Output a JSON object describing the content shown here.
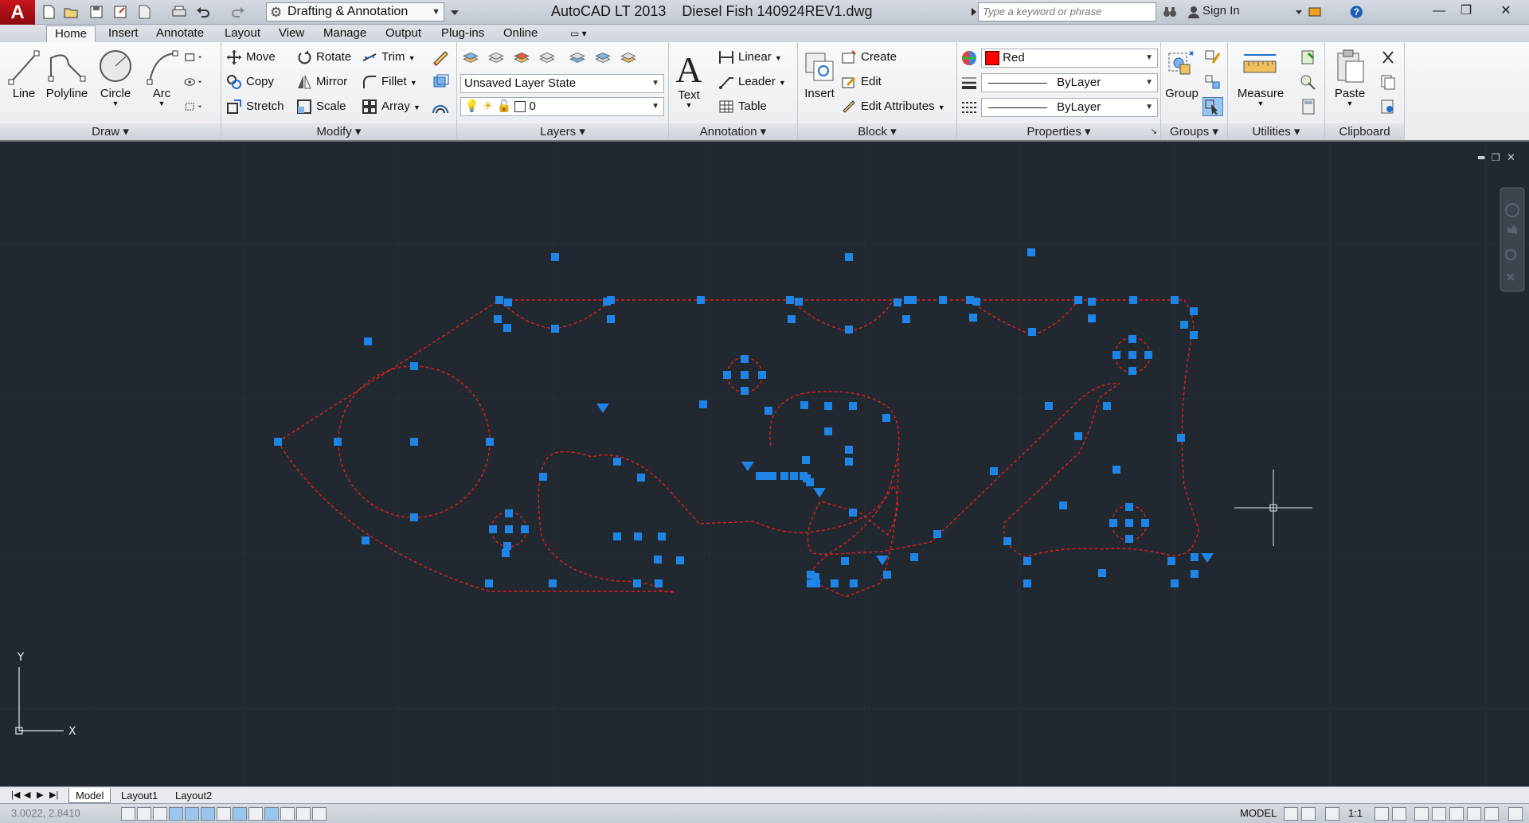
{
  "app": {
    "title": "AutoCAD LT 2013    Diesel Fish 140924REV1.dwg",
    "logo": "A",
    "workspace": "Drafting & Annotation",
    "search_placeholder": "Type a keyword or phrase",
    "signin": "Sign In",
    "help": "?"
  },
  "tabs": [
    "Home",
    "Insert",
    "Annotate",
    "Layout",
    "View",
    "Manage",
    "Output",
    "Plug-ins",
    "Online"
  ],
  "draw": {
    "title": "Draw",
    "line": "Line",
    "polyline": "Polyline",
    "circle": "Circle",
    "arc": "Arc"
  },
  "modify": {
    "title": "Modify",
    "move": "Move",
    "rotate": "Rotate",
    "trim": "Trim",
    "copy": "Copy",
    "mirror": "Mirror",
    "fillet": "Fillet",
    "stretch": "Stretch",
    "scale": "Scale",
    "array": "Array"
  },
  "layers": {
    "title": "Layers",
    "state": "Unsaved Layer State",
    "current": "0"
  },
  "annotation": {
    "title": "Annotation",
    "text": "Text",
    "linear": "Linear",
    "leader": "Leader",
    "table": "Table"
  },
  "block": {
    "title": "Block",
    "insert": "Insert",
    "create": "Create",
    "edit": "Edit",
    "edit_attributes": "Edit Attributes"
  },
  "properties": {
    "title": "Properties",
    "color": "Red",
    "color_hex": "#ff0000",
    "linetype": "ByLayer",
    "lineweight": "ByLayer"
  },
  "groups": {
    "title": "Groups",
    "group": "Group"
  },
  "utilities": {
    "title": "Utilities",
    "measure": "Measure"
  },
  "clipboard": {
    "title": "Clipboard",
    "paste": "Paste"
  },
  "canvas": {
    "background": "#212830",
    "geometry_color": "#e0201c",
    "grip_color": "#1e84e6",
    "ucs_y": "Y",
    "ucs_x": "X"
  },
  "layout_tabs": [
    "Model",
    "Layout1",
    "Layout2"
  ],
  "status": {
    "coords": "3.0022, 2.8410",
    "model": "MODEL",
    "scale": "1:1"
  }
}
